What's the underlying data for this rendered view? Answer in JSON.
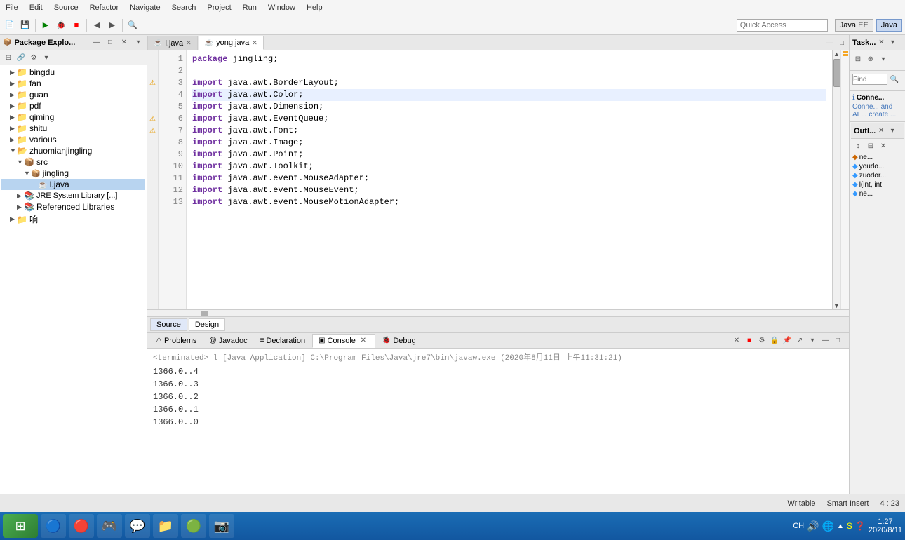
{
  "menu": {
    "items": [
      "File",
      "Edit",
      "Source",
      "Refactor",
      "Navigate",
      "Search",
      "Project",
      "Run",
      "Window",
      "Help"
    ]
  },
  "toolbar": {
    "quick_access_placeholder": "Quick Access",
    "java_ee_label": "Java EE",
    "java_label": "Java"
  },
  "left_panel": {
    "title": "Package Explo...",
    "tree": [
      {
        "label": "bingdu",
        "indent": 1,
        "type": "folder",
        "expanded": false
      },
      {
        "label": "fan",
        "indent": 1,
        "type": "folder",
        "expanded": false
      },
      {
        "label": "guan",
        "indent": 1,
        "type": "folder",
        "expanded": false
      },
      {
        "label": "pdf",
        "indent": 1,
        "type": "folder",
        "expanded": false
      },
      {
        "label": "qiming",
        "indent": 1,
        "type": "folder",
        "expanded": false
      },
      {
        "label": "shitu",
        "indent": 1,
        "type": "folder",
        "expanded": false
      },
      {
        "label": "various",
        "indent": 1,
        "type": "folder",
        "expanded": false
      },
      {
        "label": "zhuomianjingling",
        "indent": 1,
        "type": "folder",
        "expanded": true
      },
      {
        "label": "src",
        "indent": 2,
        "type": "src",
        "expanded": true
      },
      {
        "label": "jingling",
        "indent": 3,
        "type": "package",
        "expanded": true
      },
      {
        "label": "l.java",
        "indent": 4,
        "type": "file",
        "expanded": false,
        "selected": true
      },
      {
        "label": "JRE System Library [...]",
        "indent": 2,
        "type": "lib",
        "expanded": false
      },
      {
        "label": "Referenced Libraries",
        "indent": 2,
        "type": "lib",
        "expanded": false
      },
      {
        "label": "响",
        "indent": 1,
        "type": "folder",
        "expanded": false
      }
    ]
  },
  "editor": {
    "tabs": [
      {
        "label": "l.java",
        "active": false
      },
      {
        "label": "yong.java",
        "active": true
      }
    ],
    "lines": [
      {
        "num": 1,
        "code": "package jingling;",
        "type": "normal",
        "gutter": ""
      },
      {
        "num": 2,
        "code": "",
        "type": "normal",
        "gutter": ""
      },
      {
        "num": 3,
        "code": "import java.awt.BorderLayout;",
        "type": "normal",
        "gutter": "warn"
      },
      {
        "num": 4,
        "code": "import java.awt.Color;",
        "type": "highlighted",
        "gutter": ""
      },
      {
        "num": 5,
        "code": "import java.awt.Dimension;",
        "type": "normal",
        "gutter": ""
      },
      {
        "num": 6,
        "code": "import java.awt.EventQueue;",
        "type": "normal",
        "gutter": "warn"
      },
      {
        "num": 7,
        "code": "import java.awt.Font;",
        "type": "normal",
        "gutter": "warn"
      },
      {
        "num": 8,
        "code": "import java.awt.Image;",
        "type": "normal",
        "gutter": ""
      },
      {
        "num": 9,
        "code": "import java.awt.Point;",
        "type": "normal",
        "gutter": ""
      },
      {
        "num": 10,
        "code": "import java.awt.Toolkit;",
        "type": "normal",
        "gutter": ""
      },
      {
        "num": 11,
        "code": "import java.awt.event.MouseAdapter;",
        "type": "normal",
        "gutter": ""
      },
      {
        "num": 12,
        "code": "import java.awt.event.MouseEvent;",
        "type": "normal",
        "gutter": ""
      },
      {
        "num": 13,
        "code": "import java.awt.event.MouseMotionAdapter;",
        "type": "normal",
        "gutter": ""
      }
    ],
    "source_tab": "Source",
    "design_tab": "Design"
  },
  "bottom_panel": {
    "tabs": [
      "Problems",
      "Javadoc",
      "Declaration",
      "Console",
      "Debug"
    ],
    "active_tab": "Console",
    "terminated_text": "<terminated> l [Java Application] C:\\Program Files\\Java\\jre7\\bin\\javaw.exe (2020年8月11日 上午11:31:21)",
    "console_lines": [
      "1366.0..4",
      "1366.0..3",
      "1366.0..2",
      "1366.0..1",
      "1366.0..0"
    ]
  },
  "right_panel": {
    "task_title": "Task...",
    "find_placeholder": "Find",
    "connect_title": "Conne...",
    "connect_text": "Conne... and AL... create ...",
    "outline_title": "Outl...",
    "outline_items": [
      {
        "label": "ne...",
        "icon": "method"
      },
      {
        "label": "youdo...",
        "icon": "method"
      },
      {
        "label": "zuodor...",
        "icon": "method"
      },
      {
        "label": "l(int, int",
        "icon": "method"
      },
      {
        "label": "ne...",
        "icon": "method"
      }
    ]
  },
  "status_bar": {
    "writable": "Writable",
    "smart_insert": "Smart Insert",
    "position": "4 : 23"
  },
  "taskbar": {
    "apps": [
      "⊞",
      "🔵",
      "🔴",
      "🎮",
      "💬",
      "📁",
      "🟢",
      "📷"
    ],
    "system_tray": "CH 🔊 🌐 ▲",
    "time": "1:27\n2020/8/11"
  }
}
